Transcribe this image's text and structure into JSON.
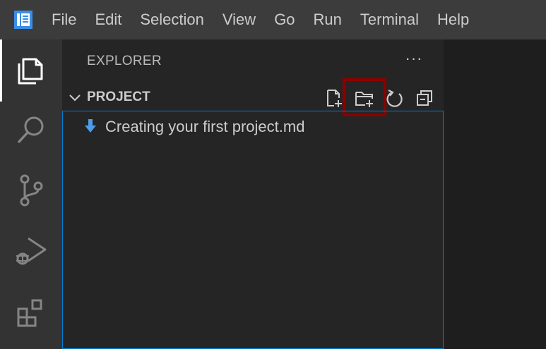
{
  "menubar": {
    "items": [
      "File",
      "Edit",
      "Selection",
      "View",
      "Go",
      "Run",
      "Terminal",
      "Help"
    ]
  },
  "activitybar": {
    "items": [
      {
        "name": "explorer",
        "icon": "files-icon",
        "active": true
      },
      {
        "name": "search",
        "icon": "search-icon",
        "active": false
      },
      {
        "name": "source-control",
        "icon": "source-control-icon",
        "active": false
      },
      {
        "name": "run-debug",
        "icon": "run-debug-icon",
        "active": false
      },
      {
        "name": "extensions",
        "icon": "extensions-icon",
        "active": false
      }
    ]
  },
  "sidebar": {
    "title": "EXPLORER",
    "more_actions": "···",
    "section": {
      "title": "PROJECT",
      "toolbar": [
        "new-file-icon",
        "new-folder-icon",
        "refresh-icon",
        "collapse-all-icon"
      ],
      "highlighted": "new-folder-icon"
    },
    "files": [
      {
        "label": "Creating your first project.md",
        "icon": "markdown-icon"
      }
    ]
  },
  "colors": {
    "menubar_bg": "#3c3c3c",
    "activitybar_bg": "#333333",
    "sidebar_bg": "#252526",
    "editor_bg": "#1e1e1e",
    "focus_border": "#007fd4",
    "highlight": "#8b0000",
    "icon_blue": "#4a9fe8"
  }
}
